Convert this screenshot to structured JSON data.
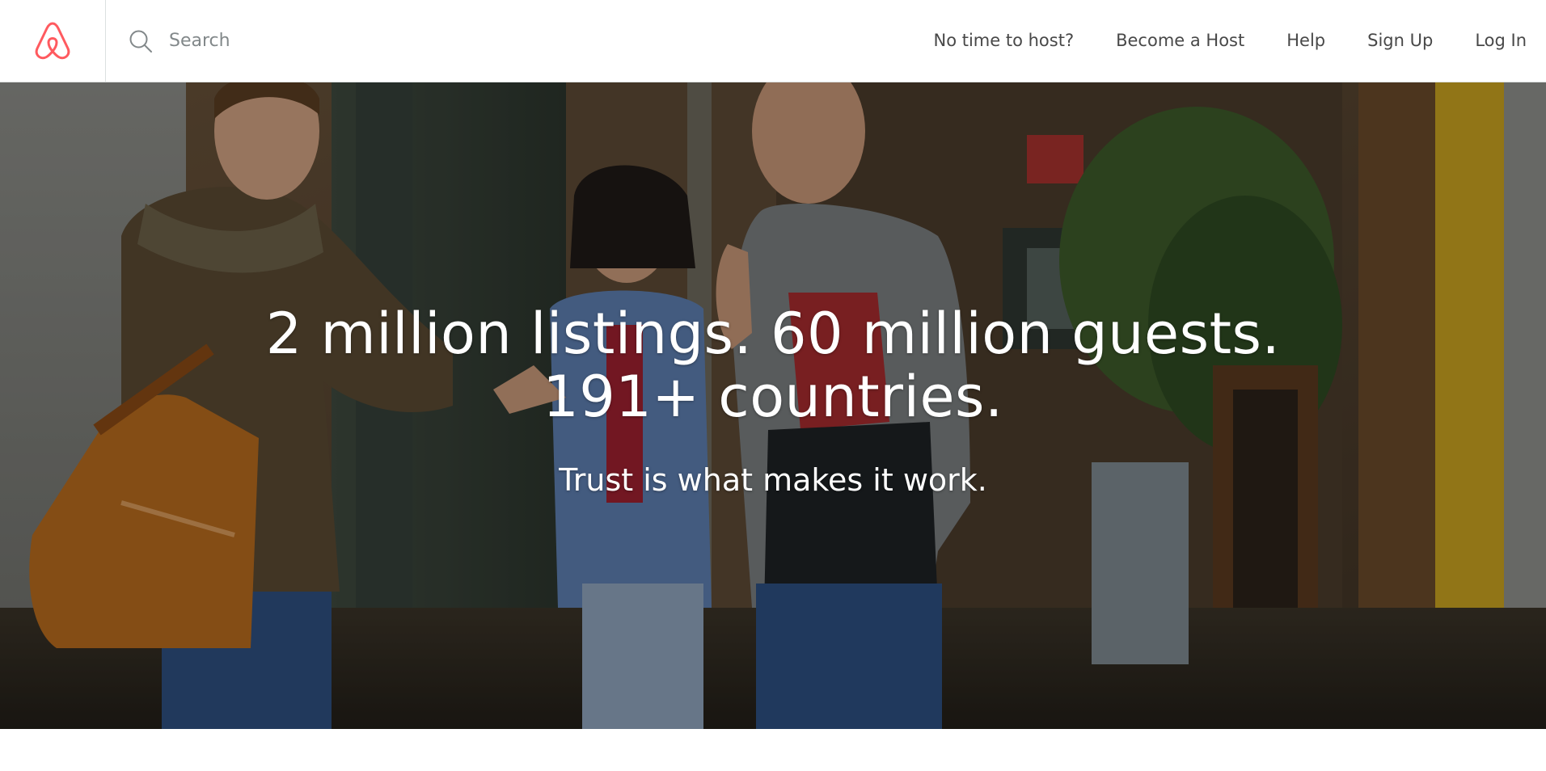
{
  "header": {
    "logo_icon": "airbnb-belo-icon",
    "brand_color": "#FF5A5F",
    "search": {
      "icon": "search-icon",
      "placeholder": "Search",
      "value": ""
    },
    "nav": {
      "no_time_to_host": "No time to host?",
      "become_a_host": "Become a Host",
      "help": "Help",
      "sign_up": "Sign Up",
      "log_in": "Log In"
    }
  },
  "hero": {
    "headline": "2 million listings. 60 million guests. 191+ countries.",
    "subheadline": "Trust is what makes it work."
  },
  "colors": {
    "text_dark": "#484848",
    "border": "#DCE0E0",
    "hero_text": "#FFFFFF"
  }
}
